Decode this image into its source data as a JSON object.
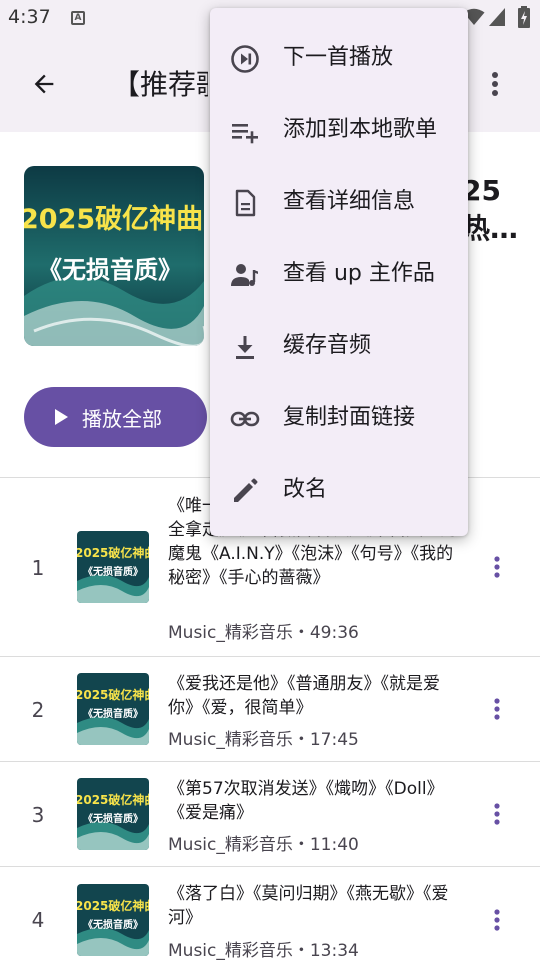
{
  "status": {
    "time": "4:37",
    "notif_icon": "A"
  },
  "app_bar": {
    "title": "【推荐歌单】2025破亿神曲"
  },
  "header": {
    "title": "25热…",
    "play_all_label": "播放全部"
  },
  "cover": {
    "line1": "2025破亿神曲",
    "line2": "《无损音质》"
  },
  "menu": {
    "items": [
      {
        "label": "下一首播放",
        "icon": "play-next-icon"
      },
      {
        "label": "添加到本地歌单",
        "icon": "playlist-add-icon"
      },
      {
        "label": "查看详细信息",
        "icon": "document-icon"
      },
      {
        "label": "查看 up 主作品",
        "icon": "person-music-icon"
      },
      {
        "label": "缓存音频",
        "icon": "download-icon"
      },
      {
        "label": "复制封面链接",
        "icon": "link-icon"
      },
      {
        "label": "改名",
        "icon": "edit-icon"
      }
    ]
  },
  "songs": [
    {
      "num": "1",
      "title": "《唯一》《光年之外》《后来》《你要的全拿走》《红蔷薇白玫瑰》《来自天堂的魔鬼《A.I.N.Y》《泡沫》《句号》《我的秘密》《手心的蔷薇》",
      "subtitle": "Music_精彩音乐・49:36"
    },
    {
      "num": "2",
      "title": "《爱我还是他》《普通朋友》《就是爱你》《爱，很简单》",
      "subtitle": "Music_精彩音乐・17:45"
    },
    {
      "num": "3",
      "title": "《第57次取消发送》《熾吻》《Doll》《爱是痛》",
      "subtitle": "Music_精彩音乐・11:40"
    },
    {
      "num": "4",
      "title": "《落了白》《莫问归期》《燕无歇》《爱河》",
      "subtitle": "Music_精彩音乐・13:34"
    }
  ],
  "colors": {
    "accent": "#6750a4",
    "surface": "#f3eff5",
    "menu_bg": "#f3edf7"
  }
}
